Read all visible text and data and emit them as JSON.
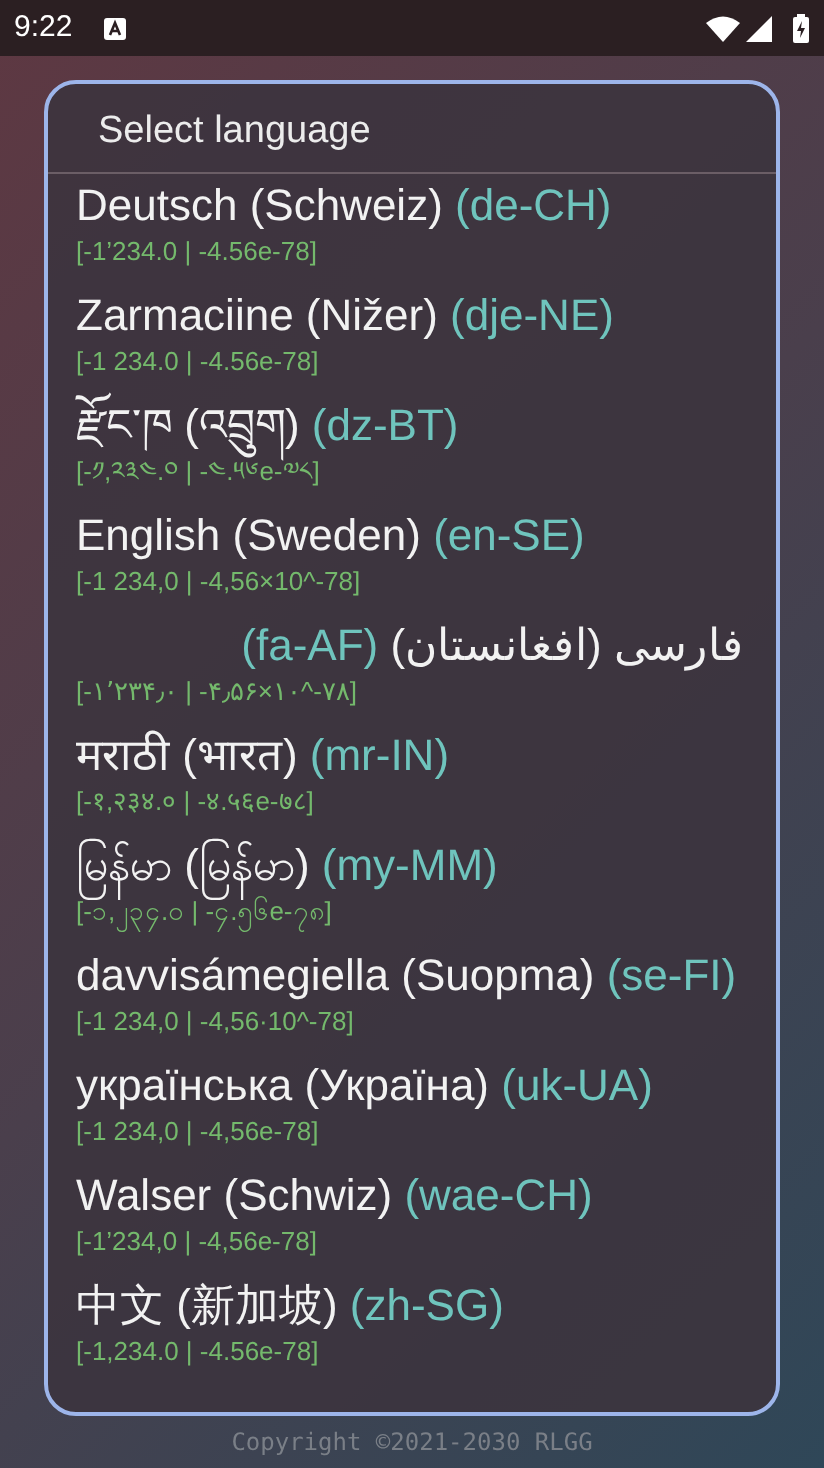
{
  "status_bar": {
    "time": "9:22"
  },
  "copyright": "Copyright ©2021-2030 RLGG",
  "dialog": {
    "title": "Select language",
    "items": [
      {
        "name": "Deutsch (Schweiz)",
        "code": "(de-CH)",
        "sample": "[-1’234.0 | -4.56e-78]",
        "rtl": false
      },
      {
        "name": "Zarmaciine (Nižer)",
        "code": "(dje-NE)",
        "sample": "[-1 234.0 | -4.56e-78]",
        "rtl": false
      },
      {
        "name": "རྫོང་ཁ (འབྲུག)",
        "code": "(dz-BT)",
        "sample": "[-༡,༢༣༤.༠ | -༤.༥༦e-༧༨]",
        "rtl": false
      },
      {
        "name": "English (Sweden)",
        "code": "(en-SE)",
        "sample": "[-1 234,0 | -4,56×10^-78]",
        "rtl": false
      },
      {
        "name": "فارسی (افغانستان)",
        "code": "(fa-AF)",
        "sample": "[-۱٬۲۳۴٫۰ | -۴٫۵۶×۱۰^-۷۸]",
        "rtl": true
      },
      {
        "name": "मराठी (भारत)",
        "code": "(mr-IN)",
        "sample": "[-१,२३४.० | -४.५६e-७८]",
        "rtl": false
      },
      {
        "name": "မြန်မာ (မြန်မာ)",
        "code": "(my-MM)",
        "sample": "[-၁,၂၃၄.၀ | -၄.၅၆e-၇၈]",
        "rtl": false
      },
      {
        "name": "davvisámegiella (Suopma)",
        "code": "(se-FI)",
        "sample": "[-1 234,0 | -4,56·10^-78]",
        "rtl": false
      },
      {
        "name": "українська (Україна)",
        "code": "(uk-UA)",
        "sample": "[-1 234,0 | -4,56e-78]",
        "rtl": false
      },
      {
        "name": "Walser (Schwiz)",
        "code": "(wae-CH)",
        "sample": "[-1’234,0 | -4,56e-78]",
        "rtl": false
      },
      {
        "name": "中文 (新加坡)",
        "code": "(zh-SG)",
        "sample": "[-1,234.0 | -4.56e-78]",
        "rtl": false
      }
    ]
  }
}
